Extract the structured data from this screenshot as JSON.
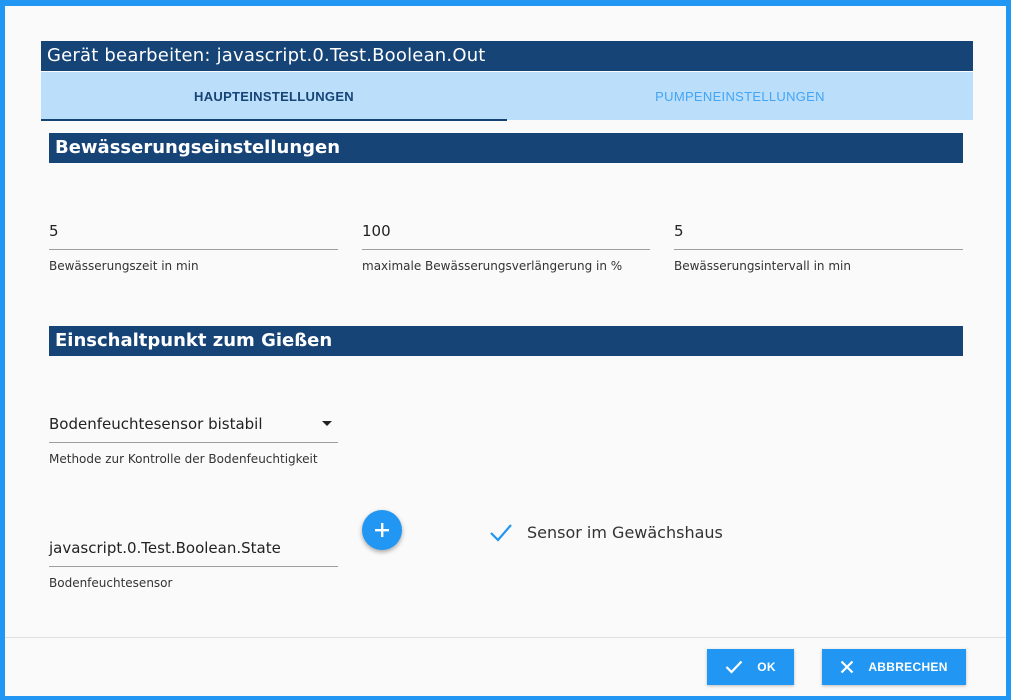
{
  "dialog": {
    "title": "Gerät bearbeiten: javascript.0.Test.Boolean.Out"
  },
  "tabs": [
    {
      "label": "HAUPTEINSTELLUNGEN",
      "active": true
    },
    {
      "label": "PUMPENEINSTELLUNGEN",
      "active": false
    }
  ],
  "irrigation": {
    "header": "Bewässerungseinstellungen",
    "time": {
      "value": "5",
      "label": "Bewässerungszeit in min"
    },
    "extension": {
      "value": "100",
      "label": "maximale Bewässerungsverlängerung in %"
    },
    "interval": {
      "value": "5",
      "label": "Bewässerungsintervall in min"
    }
  },
  "trigger": {
    "header": "Einschaltpunkt zum Gießen",
    "method": {
      "value": "Bodenfeuchtesensor bistabil",
      "label": "Methode zur Kontrolle der Bodenfeuchtigkeit"
    },
    "sensor": {
      "value": "javascript.0.Test.Boolean.State",
      "label": "Bodenfeuchtesensor"
    },
    "greenhouse": {
      "label": "Sensor im Gewächshaus",
      "checked": true
    }
  },
  "footer": {
    "ok_label": "OK",
    "cancel_label": "ABBRECHEN"
  },
  "colors": {
    "header_bg": "#164477",
    "tab_bg": "#bbdefb",
    "accent": "#2196f3"
  }
}
